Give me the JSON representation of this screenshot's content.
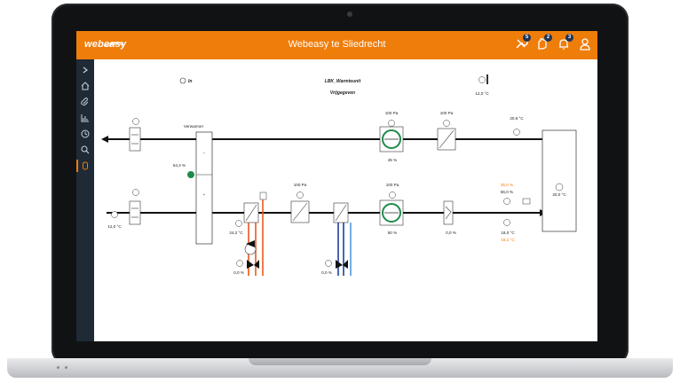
{
  "app": {
    "logo_text": "webeasy",
    "title": "Webeasy te Sliedrecht",
    "colors": {
      "brand": "#ef7d0a",
      "sidebar": "#1f2a36",
      "active": "#1e8a4a",
      "heating": "#e55a1c",
      "cooling": "#1f3f9a"
    }
  },
  "notifications": {
    "service_count": "5",
    "alarms_count": "2",
    "bell_count": "3"
  },
  "sidebar": {
    "items": [
      {
        "icon": "chevron-right-icon"
      },
      {
        "icon": "home-icon"
      },
      {
        "icon": "paperclip-icon"
      },
      {
        "icon": "chart-icon"
      },
      {
        "icon": "clock-icon"
      },
      {
        "icon": "search-icon"
      },
      {
        "icon": "document-icon"
      }
    ]
  },
  "diagram": {
    "mode_label": "In",
    "unit_name": "LBK_Warmteunit",
    "unit_status": "Vrijgegeven",
    "outdoor_temp": "12,0 °C",
    "heater_label": "Verwarmer",
    "heater_valve_pct": "54,4 %",
    "extract_fan_pressure": "100 Pa",
    "extract_filter_pressure": "100 Pa",
    "extract_fan_speed": "45 %",
    "return_temp": "20,6 °C",
    "room_temp": "20,0 °C",
    "supply_inlet_temp": "12,0 °C",
    "supply_filter_pressure": "100 Pa",
    "supply_fan_pressure": "100 Pa",
    "supply_fan_speed": "50 %",
    "damper_pct": "0,0 %",
    "setpoint_high": "35,0 %",
    "setpoint_value": "55,0 %",
    "supply_temp": "18,0 °C",
    "supply_setpoint": "18,2 °C",
    "heating_coil_temp": "24,2 °C",
    "heating_valve_pct": "0,0 %",
    "cooling_valve_pct": "0,0 %"
  }
}
